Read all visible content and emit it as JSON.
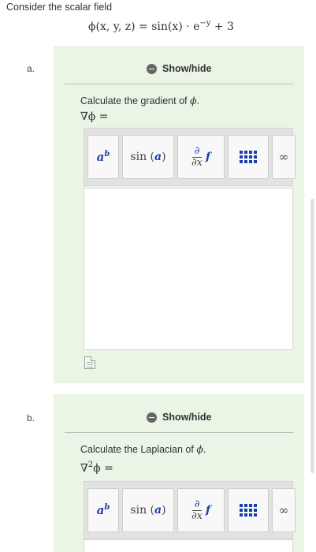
{
  "intro": "Consider the scalar field",
  "field": {
    "lhs": "ϕ(x, y, z) = sin(x) · e",
    "exp": "−y",
    "rhs": " + 3"
  },
  "parts": [
    {
      "label": "a.",
      "toggle": "Show/hide",
      "prompt_text": "Calculate the gradient of ",
      "prompt_var": "ϕ",
      "prompt_end": ".",
      "math": "∇ϕ =",
      "toolbar": [
        "a^b",
        "sin(a)",
        "∂/∂x f",
        "matrix",
        "∞"
      ]
    },
    {
      "label": "b.",
      "toggle": "Show/hide",
      "prompt_text": "Calculate the Laplacian of ",
      "prompt_var": "ϕ",
      "prompt_end": ".",
      "math_base": "∇",
      "math_exp": "2",
      "math_rest": "ϕ =",
      "toolbar": [
        "a^b",
        "sin(a)",
        "∂/∂x f",
        "matrix",
        "∞"
      ]
    }
  ],
  "toolbar_labels": {
    "pow_base": "a",
    "pow_exp": "b",
    "sin": "sin",
    "sin_arg": "a",
    "deriv_num": "∂",
    "deriv_den": "∂x",
    "deriv_f": "f",
    "inf": "∞"
  },
  "icons": [
    "minus-circle-icon",
    "matrix-icon",
    "infinity-icon",
    "file-upload-icon"
  ],
  "colors": {
    "panel": "#eaf5e6",
    "accent": "#1a3ea8"
  }
}
